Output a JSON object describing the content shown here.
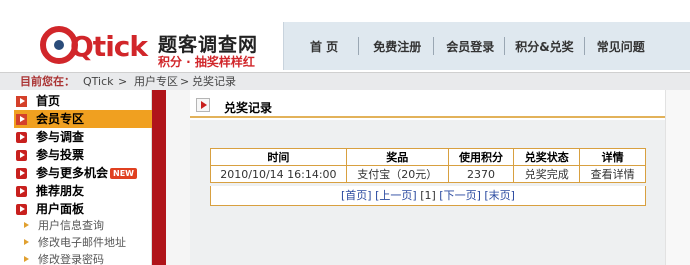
{
  "header": {
    "logo_text": "Qtick",
    "site_name": "题客调查网",
    "slogan": "积分 · 抽奖样样红"
  },
  "nav": {
    "items": [
      "首 页",
      "免费注册",
      "会员登录",
      "积分&兑奖",
      "常见问题"
    ]
  },
  "breadcrumb": {
    "label": "目前您在：",
    "items": [
      "QTick",
      "用户专区",
      "兑奖记录"
    ],
    "separator": ">"
  },
  "sidebar": {
    "items": [
      {
        "label": "首页",
        "icon": "arrow-icon"
      },
      {
        "label": "会员专区",
        "icon": "arrow-icon",
        "highlight": true
      },
      {
        "label": "参与调查",
        "icon": "red-arrow-icon"
      },
      {
        "label": "参与投票",
        "icon": "red-arrow-icon"
      },
      {
        "label": "参与更多机会",
        "icon": "red-arrow-icon",
        "badge": "NEW"
      },
      {
        "label": "推荐朋友",
        "icon": "red-arrow-icon"
      },
      {
        "label": "用户面板",
        "icon": "red-arrow-icon"
      }
    ],
    "sub_items": [
      "用户信息查询",
      "修改电子邮件地址",
      "修改登录密码"
    ]
  },
  "main": {
    "title": "兑奖记录",
    "table": {
      "columns": [
        "时间",
        "奖品",
        "使用积分",
        "兑奖状态",
        "详情"
      ],
      "rows": [
        [
          "2010/10/14 16:14:00",
          "支付宝（20元）",
          "2370",
          "兑奖完成",
          "查看详情"
        ]
      ]
    },
    "pager": {
      "first": "[首页]",
      "prev": "[上一页]",
      "current": "[1]",
      "next": "[下一页]",
      "last": "[末页]"
    }
  },
  "colors": {
    "brand_red": "#d1262a",
    "sidebar_bar": "#b0141a",
    "highlight": "#f0a020",
    "table_border": "#d8a040"
  }
}
